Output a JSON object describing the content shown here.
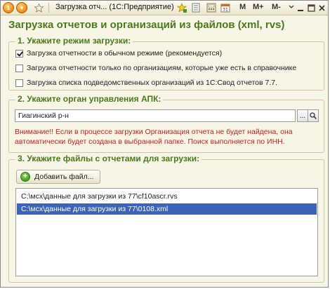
{
  "titlebar": {
    "title": "Загрузка отч...  (1С:Предприятие)",
    "letters": [
      "M",
      "M+",
      "M-"
    ]
  },
  "heading": "Загрузка отчетов и организаций из файлов (xml, rvs)",
  "section1": {
    "title": "1. Укажите режим загрузки:",
    "options": [
      {
        "label": "Загрузка отчетности в обычном режиме (рекомендуется)",
        "checked": true
      },
      {
        "label": "Загрузка отчетности только по организациям, которые уже есть в справочнике",
        "checked": false
      },
      {
        "label": "Загрузка списка подведомственных организаций из 1С:Свод  отчетов 7.7.",
        "checked": false
      }
    ]
  },
  "section2": {
    "title": "2. Укажите орган управления АПК:",
    "value": "Гиагинский р-н",
    "ellipsis": "...",
    "warning": "Внимание!! Если в процессе загрузки Организация отчета не будет найдена, она автоматически будет создана в выбранной папке. Поиск выполняется по ИНН."
  },
  "section3": {
    "title": "3. Укажите файлы с отчетами для загрузки:",
    "add_button": "Добавить файл...",
    "files": [
      "C:\\мсх\\данные для загрузки из 77\\cf10ascr.rvs",
      "C:\\мсх\\данные для загрузки из 77\\0108.xml"
    ],
    "selected_index": 1
  }
}
